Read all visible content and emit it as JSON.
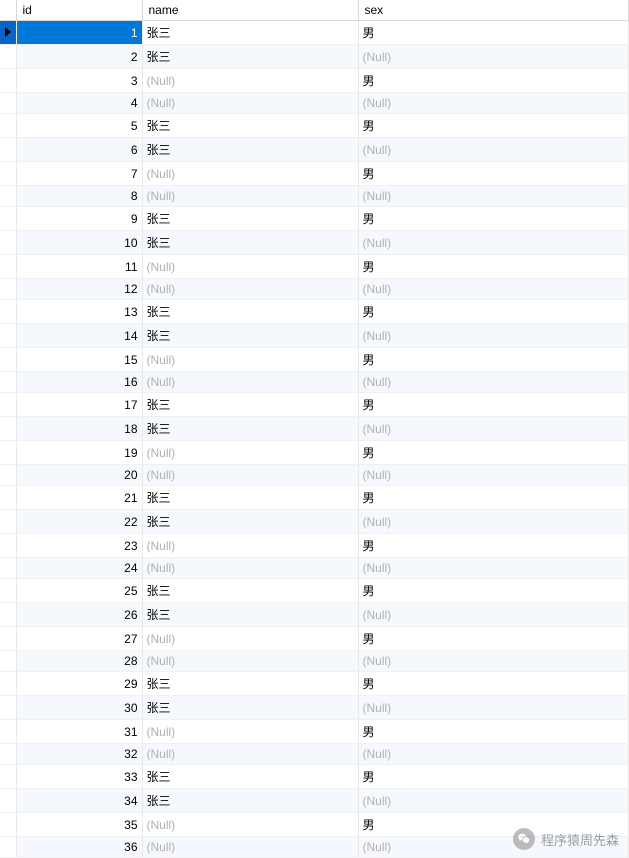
{
  "columns": {
    "id": "id",
    "name": "name",
    "sex": "sex"
  },
  "null_label": "(Null)",
  "rows": [
    {
      "id": "1",
      "name": "张三",
      "name_null": false,
      "sex": "男",
      "sex_null": false,
      "selected": true
    },
    {
      "id": "2",
      "name": "张三",
      "name_null": false,
      "sex": "",
      "sex_null": true,
      "selected": false
    },
    {
      "id": "3",
      "name": "",
      "name_null": true,
      "sex": "男",
      "sex_null": false,
      "selected": false
    },
    {
      "id": "4",
      "name": "",
      "name_null": true,
      "sex": "",
      "sex_null": true,
      "selected": false
    },
    {
      "id": "5",
      "name": "张三",
      "name_null": false,
      "sex": "男",
      "sex_null": false,
      "selected": false
    },
    {
      "id": "6",
      "name": "张三",
      "name_null": false,
      "sex": "",
      "sex_null": true,
      "selected": false
    },
    {
      "id": "7",
      "name": "",
      "name_null": true,
      "sex": "男",
      "sex_null": false,
      "selected": false
    },
    {
      "id": "8",
      "name": "",
      "name_null": true,
      "sex": "",
      "sex_null": true,
      "selected": false
    },
    {
      "id": "9",
      "name": "张三",
      "name_null": false,
      "sex": "男",
      "sex_null": false,
      "selected": false
    },
    {
      "id": "10",
      "name": "张三",
      "name_null": false,
      "sex": "",
      "sex_null": true,
      "selected": false
    },
    {
      "id": "11",
      "name": "",
      "name_null": true,
      "sex": "男",
      "sex_null": false,
      "selected": false
    },
    {
      "id": "12",
      "name": "",
      "name_null": true,
      "sex": "",
      "sex_null": true,
      "selected": false
    },
    {
      "id": "13",
      "name": "张三",
      "name_null": false,
      "sex": "男",
      "sex_null": false,
      "selected": false
    },
    {
      "id": "14",
      "name": "张三",
      "name_null": false,
      "sex": "",
      "sex_null": true,
      "selected": false
    },
    {
      "id": "15",
      "name": "",
      "name_null": true,
      "sex": "男",
      "sex_null": false,
      "selected": false
    },
    {
      "id": "16",
      "name": "",
      "name_null": true,
      "sex": "",
      "sex_null": true,
      "selected": false
    },
    {
      "id": "17",
      "name": "张三",
      "name_null": false,
      "sex": "男",
      "sex_null": false,
      "selected": false
    },
    {
      "id": "18",
      "name": "张三",
      "name_null": false,
      "sex": "",
      "sex_null": true,
      "selected": false
    },
    {
      "id": "19",
      "name": "",
      "name_null": true,
      "sex": "男",
      "sex_null": false,
      "selected": false
    },
    {
      "id": "20",
      "name": "",
      "name_null": true,
      "sex": "",
      "sex_null": true,
      "selected": false
    },
    {
      "id": "21",
      "name": "张三",
      "name_null": false,
      "sex": "男",
      "sex_null": false,
      "selected": false
    },
    {
      "id": "22",
      "name": "张三",
      "name_null": false,
      "sex": "",
      "sex_null": true,
      "selected": false
    },
    {
      "id": "23",
      "name": "",
      "name_null": true,
      "sex": "男",
      "sex_null": false,
      "selected": false
    },
    {
      "id": "24",
      "name": "",
      "name_null": true,
      "sex": "",
      "sex_null": true,
      "selected": false
    },
    {
      "id": "25",
      "name": "张三",
      "name_null": false,
      "sex": "男",
      "sex_null": false,
      "selected": false
    },
    {
      "id": "26",
      "name": "张三",
      "name_null": false,
      "sex": "",
      "sex_null": true,
      "selected": false
    },
    {
      "id": "27",
      "name": "",
      "name_null": true,
      "sex": "男",
      "sex_null": false,
      "selected": false
    },
    {
      "id": "28",
      "name": "",
      "name_null": true,
      "sex": "",
      "sex_null": true,
      "selected": false
    },
    {
      "id": "29",
      "name": "张三",
      "name_null": false,
      "sex": "男",
      "sex_null": false,
      "selected": false
    },
    {
      "id": "30",
      "name": "张三",
      "name_null": false,
      "sex": "",
      "sex_null": true,
      "selected": false
    },
    {
      "id": "31",
      "name": "",
      "name_null": true,
      "sex": "男",
      "sex_null": false,
      "selected": false
    },
    {
      "id": "32",
      "name": "",
      "name_null": true,
      "sex": "",
      "sex_null": true,
      "selected": false
    },
    {
      "id": "33",
      "name": "张三",
      "name_null": false,
      "sex": "男",
      "sex_null": false,
      "selected": false
    },
    {
      "id": "34",
      "name": "张三",
      "name_null": false,
      "sex": "",
      "sex_null": true,
      "selected": false
    },
    {
      "id": "35",
      "name": "",
      "name_null": true,
      "sex": "男",
      "sex_null": false,
      "selected": false
    },
    {
      "id": "36",
      "name": "",
      "name_null": true,
      "sex": "",
      "sex_null": true,
      "selected": false
    }
  ],
  "watermark": {
    "text": "程序猿周先森"
  }
}
